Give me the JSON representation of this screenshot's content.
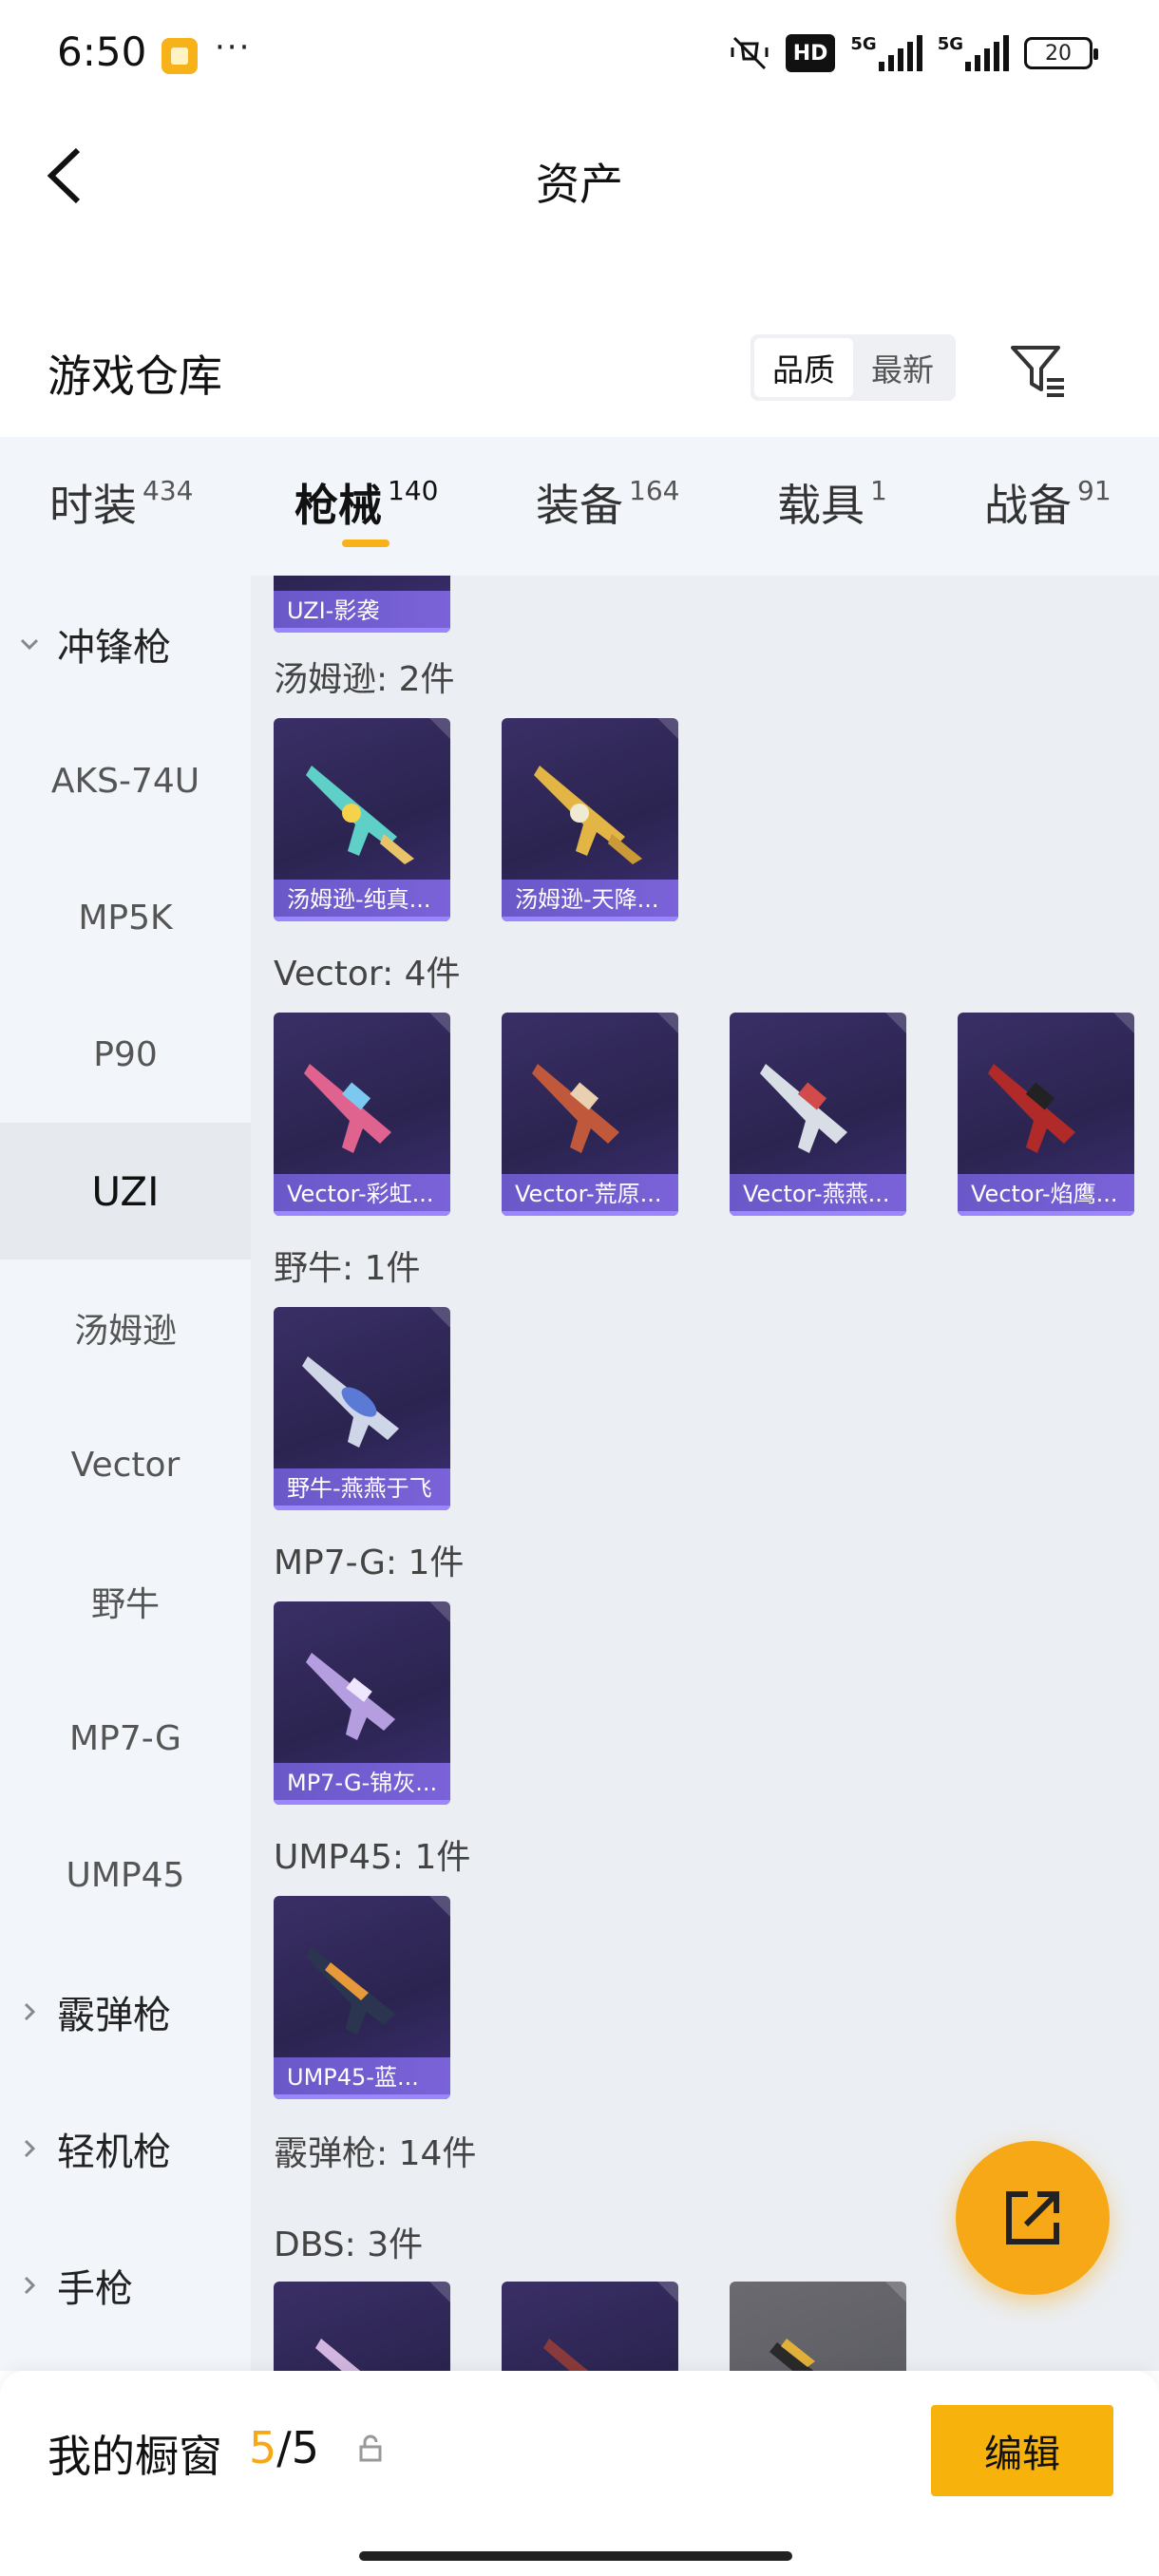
{
  "status": {
    "time": "6:50",
    "dots": "···",
    "hd": "HD",
    "net1": "5G",
    "net2": "5G",
    "battery": "20"
  },
  "header": {
    "title": "资产"
  },
  "warehouse": {
    "title": "游戏仓库",
    "sort_options": [
      "品质",
      "最新"
    ],
    "active_sort": "品质"
  },
  "tabs": [
    {
      "label": "时装",
      "count": "434"
    },
    {
      "label": "枪械",
      "count": "140",
      "active": true
    },
    {
      "label": "装备",
      "count": "164"
    },
    {
      "label": "载具",
      "count": "1"
    },
    {
      "label": "战备",
      "count": "91"
    }
  ],
  "sidebar": [
    {
      "label": "冲锋枪",
      "type": "group",
      "expanded": true
    },
    {
      "label": "AKS-74U"
    },
    {
      "label": "MP5K"
    },
    {
      "label": "P90"
    },
    {
      "label": "UZI",
      "active": true
    },
    {
      "label": "汤姆逊"
    },
    {
      "label": "Vector"
    },
    {
      "label": "野牛"
    },
    {
      "label": "MP7-G"
    },
    {
      "label": "UMP45"
    },
    {
      "label": "霰弹枪",
      "type": "group"
    },
    {
      "label": "轻机枪",
      "type": "group"
    },
    {
      "label": "手枪",
      "type": "group"
    }
  ],
  "content": {
    "partial_top_card": "UZI-影袭",
    "groups": [
      {
        "label": "汤姆逊: 2件",
        "items": [
          "汤姆逊-纯真...",
          "汤姆逊-天降..."
        ]
      },
      {
        "label": "Vector: 4件",
        "items": [
          "Vector-彩虹...",
          "Vector-荒原...",
          "Vector-燕燕...",
          "Vector-焰鹰..."
        ]
      },
      {
        "label": "野牛: 1件",
        "items": [
          "野牛-燕燕于飞"
        ]
      },
      {
        "label": "MP7-G: 1件",
        "items": [
          "MP7-G-锦灰..."
        ]
      },
      {
        "label": "UMP45: 1件",
        "items": [
          "UMP45-蓝..."
        ]
      }
    ],
    "section_label": "霰弹枪: 14件",
    "sub_label": "DBS: 3件"
  },
  "bottom": {
    "showcase_label": "我的橱窗",
    "showcase_current": "5",
    "showcase_total": "/5",
    "edit_label": "编辑"
  },
  "colors": {
    "accent": "#f7b21a",
    "fab": "#f7a816",
    "card_caption": "#7060d0"
  }
}
